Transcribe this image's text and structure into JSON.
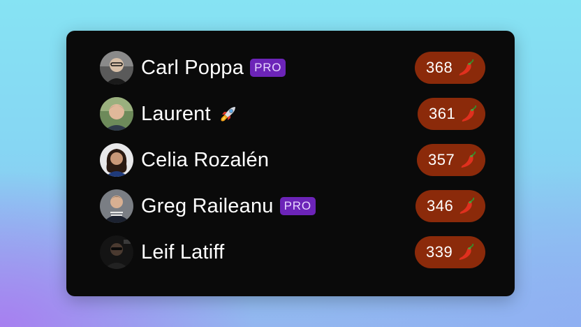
{
  "leaderboard": {
    "rows": [
      {
        "name": "Carl Poppa",
        "badge": "PRO",
        "score": "368",
        "avatar_icon": "avatar-carl"
      },
      {
        "name": "Laurent",
        "badge_emoji": "rocket-icon",
        "score": "361",
        "avatar_icon": "avatar-laurent"
      },
      {
        "name": "Celia Rozalén",
        "score": "357",
        "avatar_icon": "avatar-celia"
      },
      {
        "name": "Greg Raileanu",
        "badge": "PRO",
        "score": "346",
        "avatar_icon": "avatar-greg"
      },
      {
        "name": "Leif Latiff",
        "score": "339",
        "avatar_icon": "avatar-leif"
      }
    ],
    "score_icon": "chili-pepper-icon"
  },
  "colors": {
    "card_bg": "#0a0a0a",
    "score_pill": "#8b2a0a",
    "pro_badge": "#6c24b8",
    "text": "#ffffff"
  }
}
